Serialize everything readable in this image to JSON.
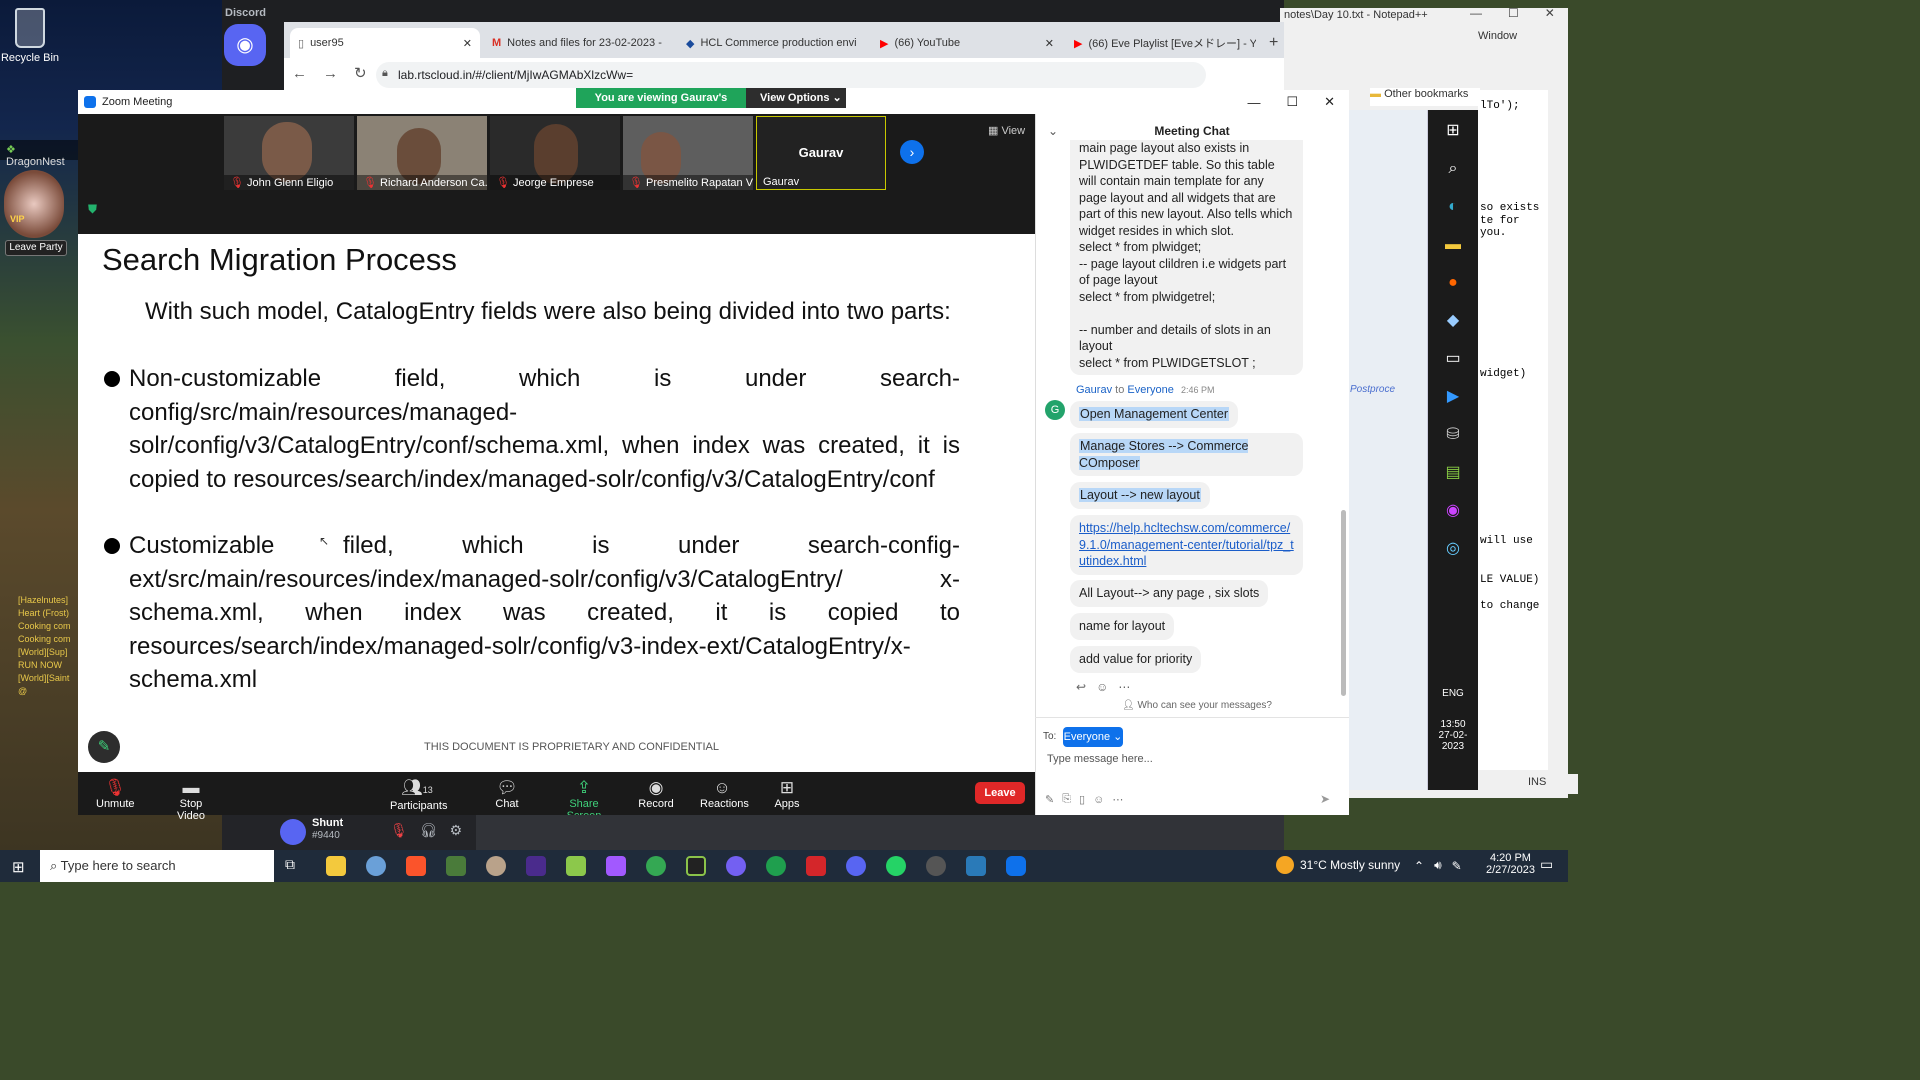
{
  "desktop": {
    "icons": [
      {
        "label": "Recycle Bin"
      },
      {
        "label": "DragonNest"
      }
    ],
    "game_panel": {
      "leave_party": "Leave Party",
      "vip": "VIP"
    },
    "game_chat": [
      "[Hazelnutes]",
      "Heart (Frost)",
      "Cooking com",
      "Cooking com",
      "[World][Sup]",
      "RUN NOW",
      "[World][Saint",
      "@"
    ]
  },
  "discord": {
    "app_title": "Discord",
    "user": {
      "name": "Shunt",
      "tag": "#9440"
    }
  },
  "browser": {
    "tabs": [
      {
        "label": "user95",
        "icon": "page-icon",
        "active": true
      },
      {
        "label": "Notes and files for 23-02-2023 -",
        "icon": "gmail-icon"
      },
      {
        "label": "HCL Commerce production envi",
        "icon": "hcl-icon"
      },
      {
        "label": "(66) YouTube",
        "icon": "youtube-icon"
      },
      {
        "label": "(66) Eve Playlist [Eveメドレー] - Yo",
        "icon": "youtube-icon"
      }
    ],
    "url": "lab.rtscloud.in/#/client/MjIwAGMAbXlzcWw=",
    "bookmarks_label": "Other bookmarks"
  },
  "notepad": {
    "title": "notes\\Day 10.txt - Notepad++",
    "menu_window": "Window",
    "code_lines": [
      "lTo');",
      "",
      "",
      "",
      "",
      "",
      "",
      "so exists",
      "te for",
      "you.",
      "",
      "",
      "",
      "",
      "",
      "",
      " widget)",
      "",
      "",
      "",
      "",
      "",
      "",
      "",
      "",
      "",
      "will use",
      "",
      "",
      "LE VALUE)",
      "",
      "to change"
    ],
    "postprocess": "Postproce",
    "status": "INS",
    "clock": {
      "time": "13:50",
      "date": "27-02-2023",
      "lang": "ENG"
    }
  },
  "zoom": {
    "window_title": "Zoom Meeting",
    "share_banner": "You are viewing Gaurav's screen",
    "view_options": "View Options",
    "view_label": "View",
    "participants": [
      {
        "name": "John Glenn Eligio",
        "muted": true
      },
      {
        "name": "Richard Anderson Ca...",
        "muted": true
      },
      {
        "name": "Jeorge Emprese",
        "muted": true
      },
      {
        "name": "Presmelito Rapatan V...",
        "muted": true
      },
      {
        "name": "Gaurav",
        "muted": false,
        "display_name": "Gaurav"
      }
    ],
    "slide": {
      "title": "Search Migration Process",
      "intro": "With such model, CatalogEntry fields were also being divided into two parts:",
      "bullets": [
        "Non-customizable field, which is under search-config/src/main/resources/managed-solr/config/v3/CatalogEntry/conf/schema.xml, when index was created, it is copied to resources/search/index/managed-solr/config/v3/CatalogEntry/conf",
        "Customizable filed, which is under search-config-ext/src/main/resources/index/managed-solr/config/v3/CatalogEntry/ x-schema.xml, when index was created, it is copied to resources/search/index/managed-solr/config/v3-index-ext/CatalogEntry/x-schema.xml"
      ],
      "footer": "THIS DOCUMENT IS PROPRIETARY AND CONFIDENTIAL"
    },
    "toolbar": {
      "unmute": "Unmute",
      "stop_video": "Stop Video",
      "participants": "Participants",
      "participant_count": "13",
      "chat": "Chat",
      "share_screen": "Share Screen",
      "record": "Record",
      "reactions": "Reactions",
      "apps": "Apps",
      "leave": "Leave"
    },
    "chat": {
      "title": "Meeting Chat",
      "earlier_message": "main page layout also exists in PLWIDGETDEF table. So this table will contain main template for any page layout and all widgets that are part of this new layout. Also tells which widget resides in which slot.\nselect * from plwidget;\n-- page layout clildren i.e widgets part of page layout\nselect * from plwidgetrel;\n\n-- number and details of slots in an layout\nselect * from PLWIDGETSLOT ;",
      "sender_line": {
        "from": "Gaurav",
        "to_word": "to",
        "to": "Everyone",
        "time": "2:46 PM",
        "avatar": "G"
      },
      "messages": [
        "Open Management Center",
        "Manage Stores --> Commerce COmposer",
        "Layout --> new layout",
        "https://help.hcltechsw.com/commerce/9.1.0/management-center/tutorial/tpz_tutindex.html",
        "All Layout--> any page , six slots",
        "name for layout",
        "add value for priority"
      ],
      "who_can_see": "Who can see your messages?",
      "to_label": "To:",
      "to_value": "Everyone",
      "input_placeholder": "Type message here..."
    }
  },
  "taskbar": {
    "search_placeholder": "Type here to search",
    "weather": "31°C  Mostly sunny",
    "time": "4:20 PM",
    "date": "2/27/2023"
  },
  "colors": {
    "zoom_green": "#1fa45a",
    "zoom_blue": "#0e71eb",
    "leave_red": "#e02828",
    "link_blue": "#1a5dc9",
    "highlight": "#b8d7f7"
  }
}
